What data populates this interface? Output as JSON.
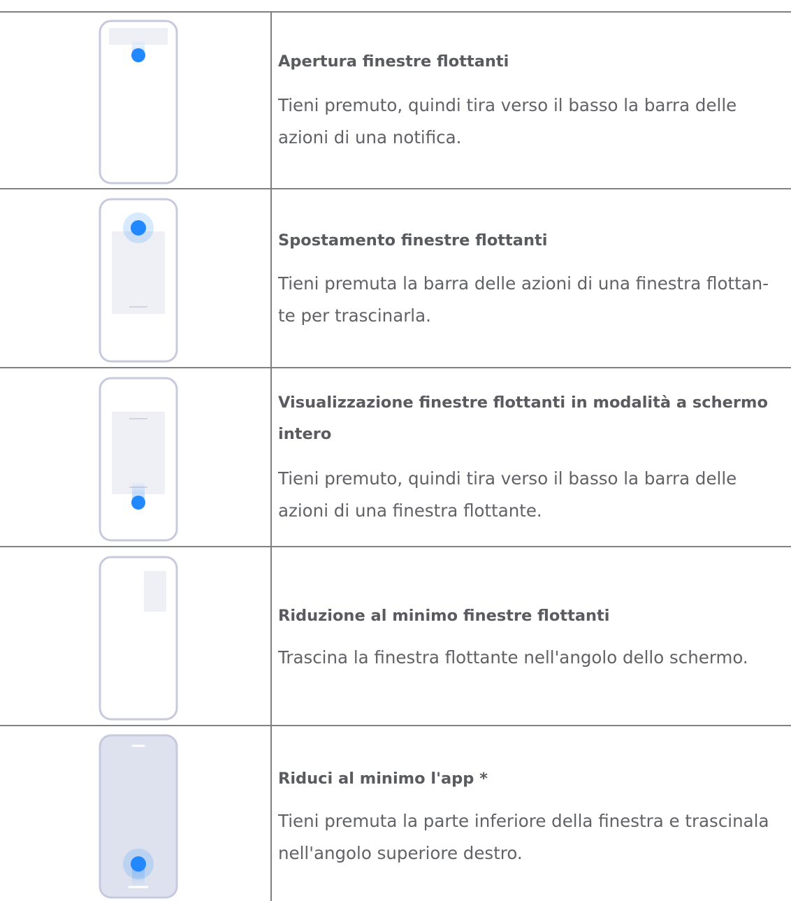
{
  "rows": [
    {
      "title": "Apertura finestre flottanti",
      "desc_line1": "Tieni premuto, quindi tira verso il basso la barra delle",
      "desc_line2": "azioni di una notifica.",
      "icon": "phone-notification-pull-down-icon"
    },
    {
      "title": "Spostamento finestre flottanti",
      "desc_line1": "Tieni premuta la barra delle azioni di una finestra flottan-",
      "desc_line2": "te per trascinarla.",
      "icon": "phone-drag-floating-window-icon"
    },
    {
      "title_line1": "Visualizzazione finestre flottanti in modalità a schermo",
      "title_line2": "intero",
      "desc_line1": "Tieni premuto, quindi tira verso il basso la barra delle",
      "desc_line2": "azioni di una finestra flottante.",
      "icon": "phone-fullscreen-window-icon"
    },
    {
      "title": "Riduzione al minimo finestre flottanti",
      "desc_line1": "Trascina la finestra flottante nell'angolo dello schermo.",
      "icon": "phone-minimize-window-icon"
    },
    {
      "title": "Riduci al minimo l'app *",
      "desc_line1": "Tieni premuta la parte inferiore della finestra e trascinala",
      "desc_line2": "nell'angolo superiore destro.",
      "icon": "phone-minimize-app-icon"
    }
  ],
  "colors": {
    "grid_line": "#808083",
    "phone_outline": "#c7c9de",
    "touch_dot": "#2188ff",
    "window_fill": "#eef0f6",
    "screen_fill": "#dde2ee"
  }
}
